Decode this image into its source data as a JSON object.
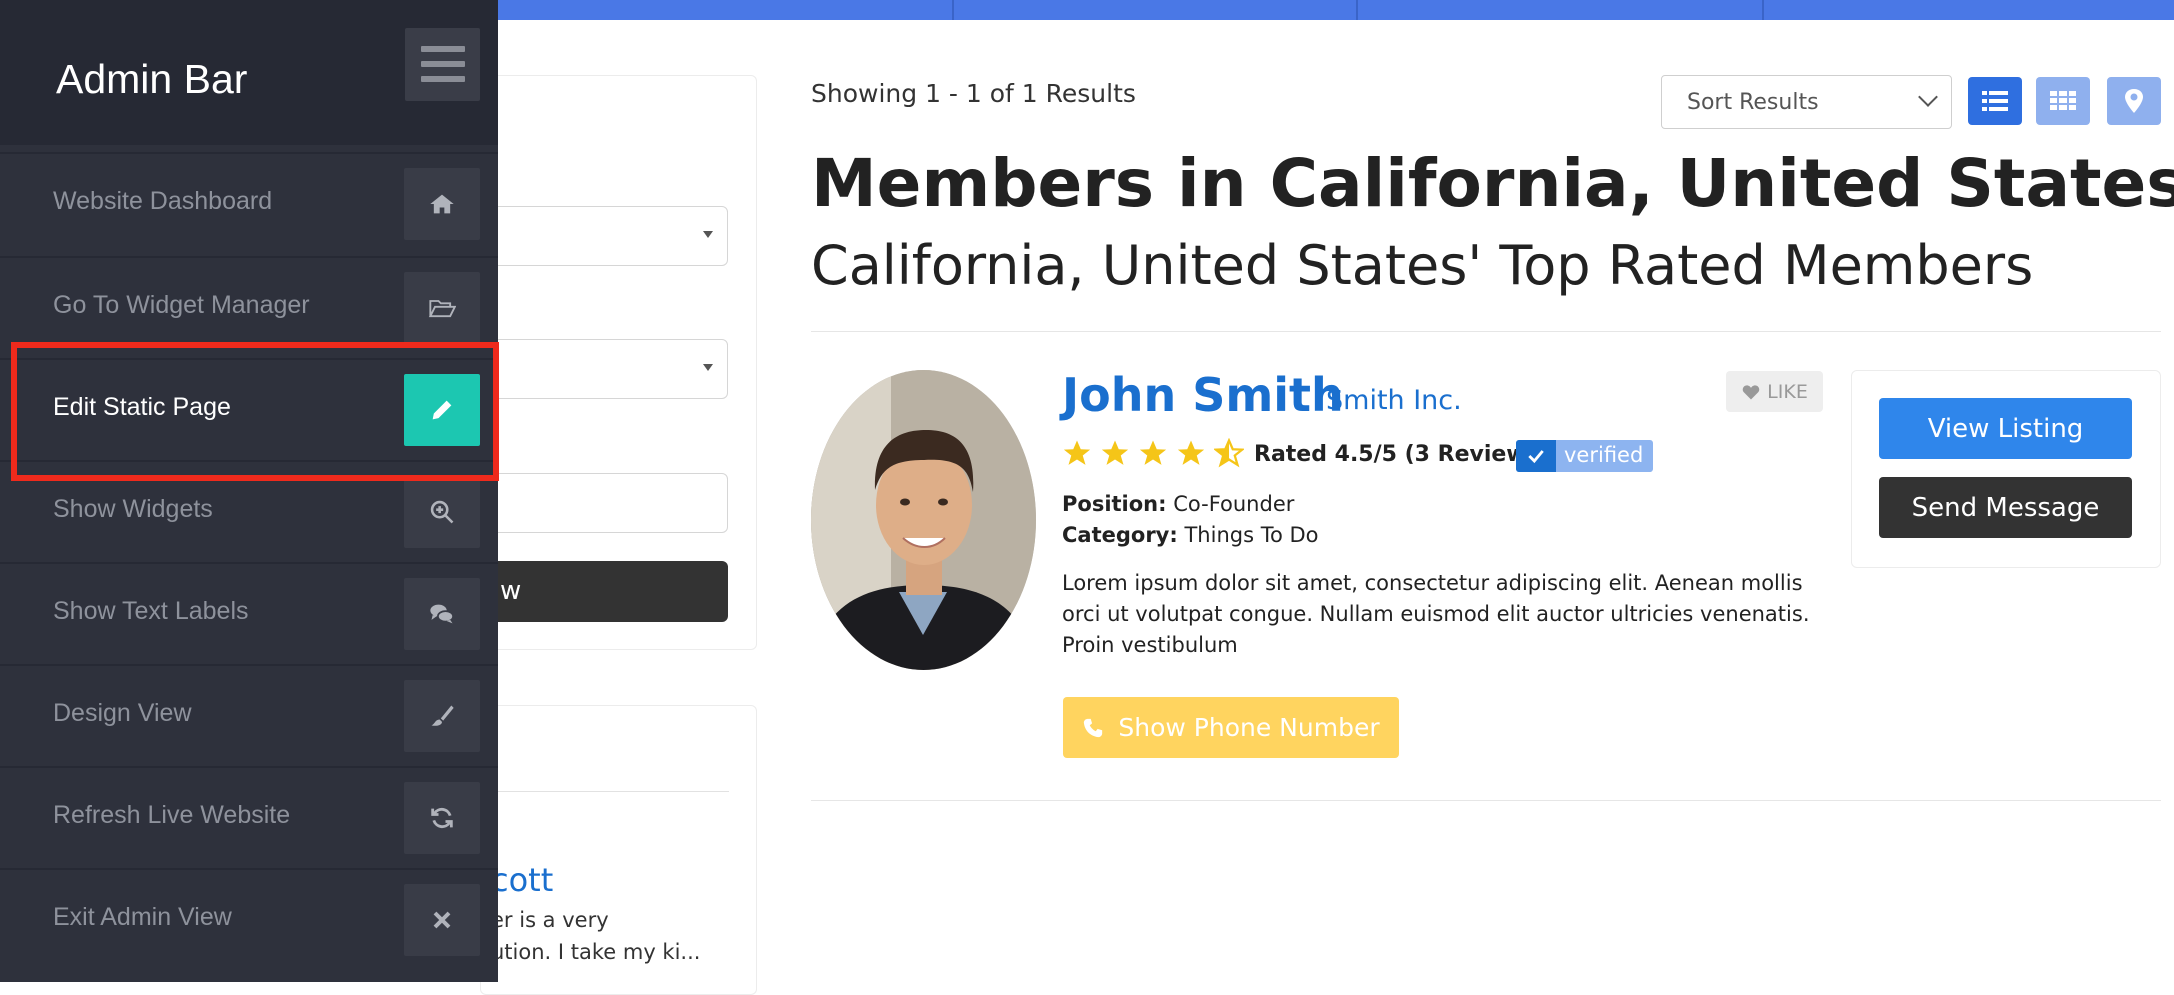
{
  "admin_bar": {
    "title": "Admin Bar",
    "menu_icon": "hamburger-icon",
    "items": [
      {
        "label": "Website Dashboard",
        "icon": "home-icon"
      },
      {
        "label": "Go To Widget Manager",
        "icon": "folder-open-icon"
      },
      {
        "label": "Edit Static Page",
        "icon": "pencil-icon",
        "active": true
      },
      {
        "label": "Show Widgets",
        "icon": "zoom-in-icon"
      },
      {
        "label": "Show Text Labels",
        "icon": "comments-icon"
      },
      {
        "label": "Design View",
        "icon": "brush-icon"
      },
      {
        "label": "Refresh Live Website",
        "icon": "refresh-icon"
      },
      {
        "label": "Exit Admin View",
        "icon": "close-icon"
      }
    ],
    "active_color": "#1cc7b1",
    "highlight_color": "#ef2a1c"
  },
  "filters": {
    "button_fragment": "w",
    "preview": {
      "name_fragment": "cott",
      "text_fragment": "er is a very\nution. I take my ki..."
    }
  },
  "results": {
    "showing": "Showing 1 - 1 of 1 Results",
    "sort_label": "Sort Results",
    "view_icons": [
      "list-view-icon",
      "grid-view-icon",
      "map-marker-icon"
    ],
    "title": "Members in California, United States",
    "subtitle": "California, United States' Top Rated Members"
  },
  "member": {
    "name": "John Smith",
    "company": "Smith Inc.",
    "like_label": "LIKE",
    "rating": 4.5,
    "rating_text": "Rated 4.5/5 (3 Reviews)",
    "verified_label": "verified",
    "position_label": "Position:",
    "position_value": "Co-Founder",
    "category_label": "Category:",
    "category_value": "Things To Do",
    "description": "Lorem ipsum dolor sit amet, consectetur adipiscing elit. Aenean mollis orci ut volutpat congue. Nullam euismod elit auctor ultricies venenatis. Proin vestibulum",
    "phone_button": "Show Phone Number",
    "view_listing": "View Listing",
    "send_message": "Send Message"
  },
  "colors": {
    "accent_blue": "#1a6fce",
    "top_bar": "#4a78e6",
    "phone_button": "#ffd45f",
    "star": "#f5c518"
  }
}
